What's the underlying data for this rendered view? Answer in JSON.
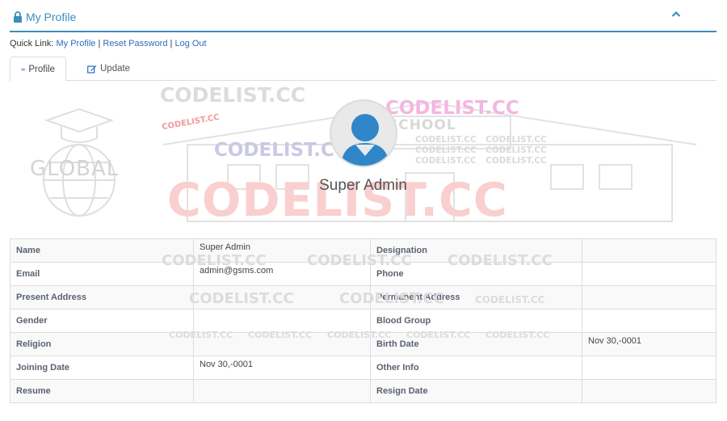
{
  "panel": {
    "title": "My Profile",
    "lock_icon": "lock-icon",
    "collapse_icon": "chevron-up-icon"
  },
  "quick_links": {
    "prefix": "Quick Link:",
    "my_profile": "My Profile",
    "reset_password": "Reset Password",
    "log_out": "Log Out",
    "separator": "|"
  },
  "tabs": [
    {
      "label": "Profile",
      "icon": "eye-icon",
      "active": true
    },
    {
      "label": "Update",
      "icon": "edit-icon",
      "active": false
    }
  ],
  "profile": {
    "name": "Super Admin"
  },
  "watermarks": {
    "site": "CODELIST.CC",
    "emblem_text": "GLOBAL",
    "school_text": "SCHOOL"
  },
  "table": {
    "rows": [
      {
        "label": "Name",
        "value": "Super Admin",
        "label2": "Designation",
        "value2": ""
      },
      {
        "label": "Email",
        "value": "admin@gsms.com",
        "label2": "Phone",
        "value2": ""
      },
      {
        "label": "Present Address",
        "value": "",
        "label2": "Permanent Address",
        "value2": ""
      },
      {
        "label": "Gender",
        "value": "",
        "label2": "Blood Group",
        "value2": ""
      },
      {
        "label": "Religion",
        "value": "",
        "label2": "Birth Date",
        "value2": "Nov 30,-0001"
      },
      {
        "label": "Joining Date",
        "value": "Nov 30,-0001",
        "label2": "Other Info",
        "value2": ""
      },
      {
        "label": "Resume",
        "value": "",
        "label2": "Resign Date",
        "value2": ""
      }
    ]
  },
  "colors": {
    "accent": "#3c8dbc",
    "link": "#2a6ebb",
    "avatar": "#2f86c9",
    "watermark_red": "#f08080"
  }
}
